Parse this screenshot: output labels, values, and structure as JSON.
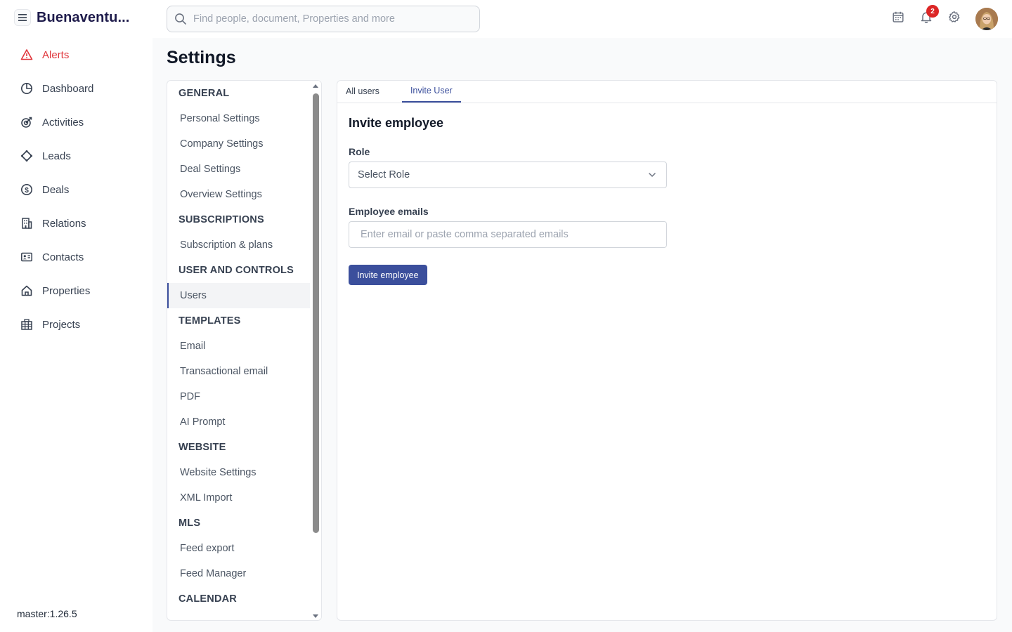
{
  "app": {
    "brand": "Buenaventu...",
    "version": "master:1.26.5"
  },
  "search": {
    "placeholder": "Find people, document, Properties and more"
  },
  "header": {
    "notification_count": "2"
  },
  "sidebar": {
    "items": [
      {
        "label": "Alerts",
        "icon": "alert-triangle-icon"
      },
      {
        "label": "Dashboard",
        "icon": "pie-chart-icon"
      },
      {
        "label": "Activities",
        "icon": "activity-icon"
      },
      {
        "label": "Leads",
        "icon": "leads-icon"
      },
      {
        "label": "Deals",
        "icon": "dollar-circle-icon"
      },
      {
        "label": "Relations",
        "icon": "building-icon"
      },
      {
        "label": "Contacts",
        "icon": "contact-card-icon"
      },
      {
        "label": "Properties",
        "icon": "home-icon"
      },
      {
        "label": "Projects",
        "icon": "projects-icon"
      }
    ]
  },
  "page": {
    "title": "Settings"
  },
  "settings_menu": {
    "general": "GENERAL",
    "personal": "Personal Settings",
    "company": "Company Settings",
    "deal": "Deal Settings",
    "overview": "Overview Settings",
    "subscriptions": "SUBSCRIPTIONS",
    "subscription_plans": "Subscription & plans",
    "user_controls": "USER AND CONTROLS",
    "users": "Users",
    "templates": "TEMPLATES",
    "email": "Email",
    "transactional": "Transactional email",
    "pdf": "PDF",
    "ai_prompt": "AI Prompt",
    "website": "WEBSITE",
    "website_settings": "Website Settings",
    "xml_import": "XML Import",
    "mls": "MLS",
    "feed_export": "Feed export",
    "feed_manager": "Feed Manager",
    "calendar": "CALENDAR"
  },
  "tabs": {
    "all_users": "All users",
    "invite_user": "Invite User"
  },
  "invite_form": {
    "title": "Invite employee",
    "role_label": "Role",
    "role_value": "Select Role",
    "emails_label": "Employee emails",
    "emails_placeholder": "Enter email or paste comma separated emails",
    "submit": "Invite employee"
  },
  "colors": {
    "accent": "#3b4f9c",
    "alert": "#e0353b",
    "badge": "#dc2626"
  }
}
